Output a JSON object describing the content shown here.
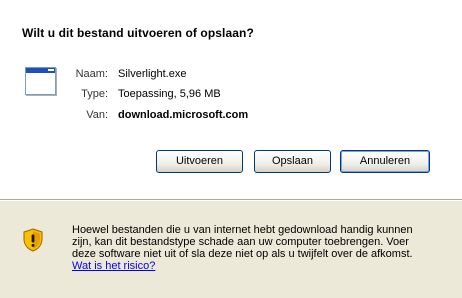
{
  "dialog": {
    "heading": "Wilt u dit bestand uitvoeren of opslaan?",
    "file": {
      "icon": "application-window-icon",
      "name_label": "Naam:",
      "name_value": "Silverlight.exe",
      "type_label": "Type:",
      "type_value": "Toepassing, 5,96 MB",
      "from_label": "Van:",
      "from_value": "download.microsoft.com"
    },
    "buttons": {
      "run": "Uitvoeren",
      "save": "Opslaan",
      "cancel": "Annuleren"
    },
    "warning": {
      "icon": "security-shield-warning-icon",
      "text": "Hoewel bestanden die u van internet hebt gedownload handig kunnen zijn, kan dit bestandstype schade aan uw computer toebrengen. Voer deze software niet uit of sla deze niet op als u twijfelt over de afkomst.",
      "link": "Wat is het risico?"
    },
    "colors": {
      "panel": "#ffffff",
      "dialog_bg": "#ece9d8",
      "link": "#0000ff",
      "shield_yellow": "#f7c000",
      "shield_orange": "#e08000"
    }
  }
}
